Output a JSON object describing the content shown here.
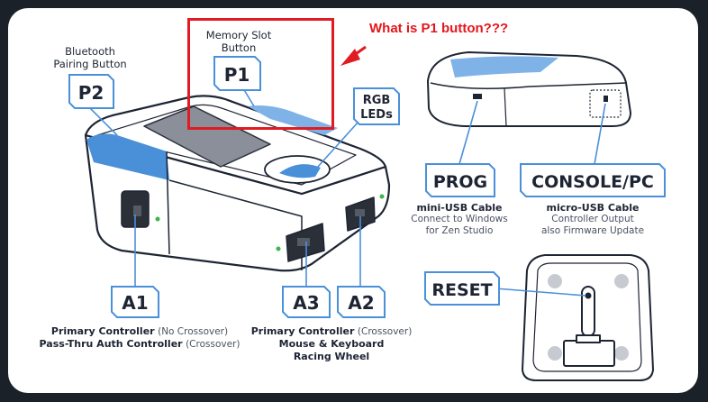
{
  "annotation": {
    "question": "What is P1 button???",
    "colors": {
      "highlight": "#e11b22",
      "accent": "#4a90d9",
      "ink": "#1d2433"
    }
  },
  "device_labels": {
    "p2": {
      "code": "P2",
      "caption_line1": "Bluetooth",
      "caption_line2": "Pairing Button"
    },
    "p1": {
      "code": "P1",
      "caption_line1": "Memory Slot",
      "caption_line2": "Button"
    },
    "rgb": {
      "line1": "RGB",
      "line2": "LEDs"
    },
    "a1": {
      "code": "A1",
      "caption_line1_main": "Primary Controller",
      "caption_line1_sub": "(No Crossover)",
      "caption_line2_main": "Pass-Thru Auth Controller",
      "caption_line2_sub": "(Crossover)"
    },
    "a3": {
      "code": "A3"
    },
    "a2": {
      "code": "A2",
      "caption_line1_main": "Primary Controller",
      "caption_line1_sub": "(Crossover)",
      "caption_line2": "Mouse & Keyboard",
      "caption_line3": "Racing Wheel"
    }
  },
  "ports": {
    "prog": {
      "code": "PROG",
      "title": "mini-USB Cable",
      "line1": "Connect to Windows",
      "line2": "for Zen Studio"
    },
    "console": {
      "code": "CONSOLE/PC",
      "title": "micro-USB Cable",
      "line1": "Controller Output",
      "line2": "also Firmware Update"
    },
    "reset": {
      "code": "RESET"
    }
  }
}
